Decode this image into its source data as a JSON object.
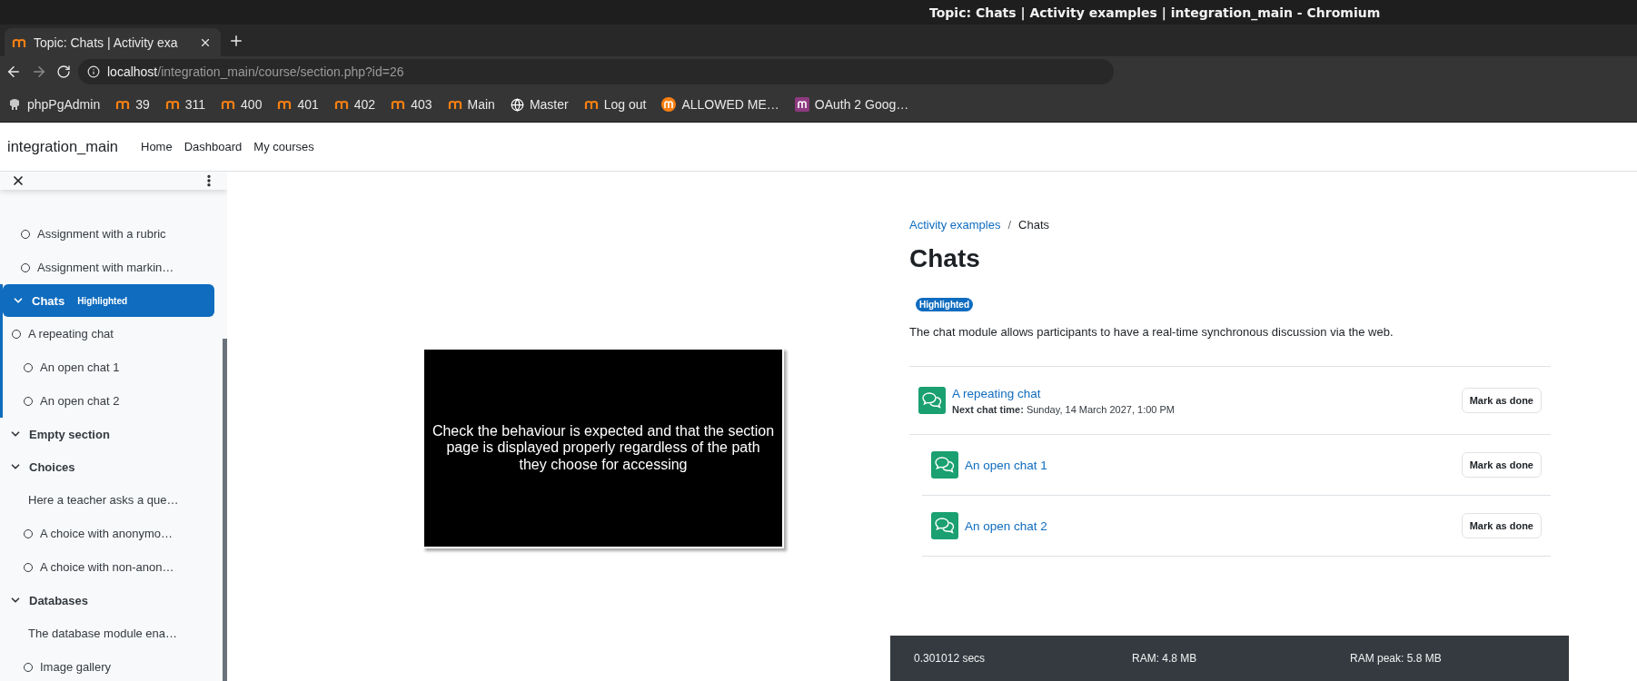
{
  "browser": {
    "window_title": "Topic: Chats | Activity examples | integration_main - Chromium",
    "tab": {
      "title": "Topic: Chats | Activity exa"
    },
    "url": {
      "host": "localhost",
      "path": "/integration_main/course/section.php?id=26"
    },
    "bookmarks": [
      {
        "label": "phpPgAdmin",
        "kind": "elephant"
      },
      {
        "label": "39",
        "kind": "moodle"
      },
      {
        "label": "311",
        "kind": "moodle"
      },
      {
        "label": "400",
        "kind": "moodle"
      },
      {
        "label": "401",
        "kind": "moodle"
      },
      {
        "label": "402",
        "kind": "moodle"
      },
      {
        "label": "403",
        "kind": "moodle"
      },
      {
        "label": "Main",
        "kind": "moodle"
      },
      {
        "label": "Master",
        "kind": "globe"
      },
      {
        "label": "Log out",
        "kind": "moodle"
      },
      {
        "label": "ALLOWED ME…",
        "kind": "round"
      },
      {
        "label": "OAuth 2 Goog…",
        "kind": "square"
      }
    ]
  },
  "navbar": {
    "brand": "integration_main",
    "links": [
      "Home",
      "Dashboard",
      "My courses"
    ]
  },
  "sidebar": {
    "items": [
      {
        "kind": "activity",
        "label": "Assignment with a rubric"
      },
      {
        "kind": "activity",
        "label": "Assignment with markin…"
      },
      {
        "kind": "section",
        "label": "Chats",
        "badge": "Highlighted",
        "selected": true,
        "expanded": true,
        "children": [
          {
            "kind": "top_activity",
            "label": "A repeating chat"
          },
          {
            "kind": "activity",
            "label": "An open chat 1"
          },
          {
            "kind": "activity",
            "label": "An open chat 2"
          }
        ]
      },
      {
        "kind": "section",
        "label": "Empty section",
        "selected": false,
        "expanded": true
      },
      {
        "kind": "section",
        "label": "Choices",
        "selected": false,
        "expanded": true,
        "children": [
          {
            "kind": "text",
            "label": "Here a teacher asks a que…"
          },
          {
            "kind": "activity",
            "label": "A choice with anonymo…"
          },
          {
            "kind": "activity",
            "label": "A choice with non-anon…"
          }
        ]
      },
      {
        "kind": "section",
        "label": "Databases",
        "selected": false,
        "expanded": true,
        "children": [
          {
            "kind": "text",
            "label": "The database module ena…"
          },
          {
            "kind": "activity",
            "label": "Image gallery"
          }
        ]
      }
    ]
  },
  "notice": "Check the behaviour is expected and that the section page is displayed properly regardless of the path they choose for accessing",
  "breadcrumb": [
    {
      "label": "Activity examples",
      "link": true
    },
    {
      "label": "Chats",
      "link": false
    }
  ],
  "breadcrumb_separator": "/",
  "heading": "Chats",
  "badge": "Highlighted",
  "description": "The chat module allows participants to have a real-time synchronous discussion via the web.",
  "activities": [
    {
      "kind": "standard",
      "title": "A repeating chat",
      "detail": "**Next chat time:** Sunday, 14 March 2027, 1:00 PM",
      "button": "Mark as done"
    },
    {
      "kind": "indented",
      "title": "An open chat 1",
      "button": "Mark as done"
    },
    {
      "kind": "indented",
      "title": "An open chat 2",
      "button": "Mark as done"
    }
  ],
  "footer": [
    "0.301012 secs",
    "RAM: 4.8 MB",
    "RAM peak: 5.8 MB"
  ]
}
